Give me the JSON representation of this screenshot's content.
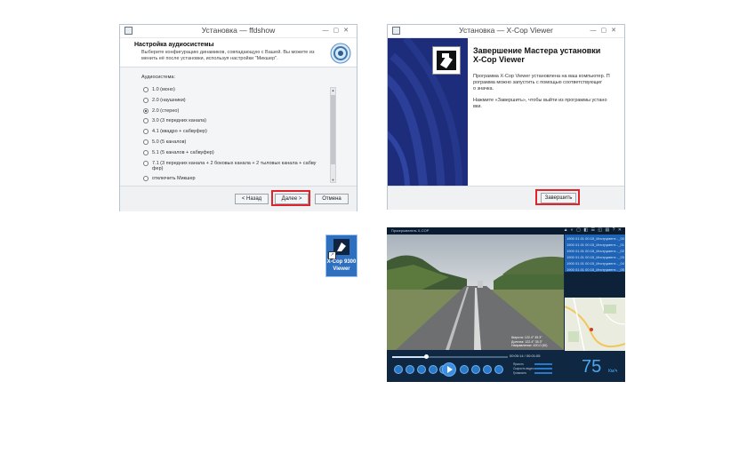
{
  "ffdshow": {
    "title": "Установка — ffdshow",
    "header_title": "Настройка аудиосистемы",
    "header_desc_1": "Выберите конфигурацию динамиков, совпадающую с Вашей. Вы можете из",
    "header_desc_2": "менить её после установки, используя настройки \"Микшер\".",
    "group_label": "Аудиосистема:",
    "options": [
      {
        "label": "1.0 (моно)",
        "checked": false
      },
      {
        "label": "2.0 (наушники)",
        "checked": false
      },
      {
        "label": "2.0 (стерео)",
        "checked": true
      },
      {
        "label": "3.0 (3 передних канала)",
        "checked": false
      },
      {
        "label": "4.1 (квадро + сабвуфер)",
        "checked": false
      },
      {
        "label": "5.0 (5 каналов)",
        "checked": false
      },
      {
        "label": "5.1 (5 каналов + сабвуфер)",
        "checked": false
      },
      {
        "label": "7.1 (3 передних канала + 2 боковых канала + 2 тыловых канала + сабву",
        "label2": "фер)",
        "checked": false
      },
      {
        "label": "отключить Микшер",
        "checked": false
      }
    ],
    "back_button": "< Назад",
    "next_button": "Далее >",
    "cancel_button": "Отмена"
  },
  "xcop_installer": {
    "title": "Установка — X-Cop Viewer",
    "finish_title_1": "Завершение Мастера установки",
    "finish_title_2": "X-Cop Viewer",
    "text_1": "Программа X-Cop Viewer установлена на ваш компьютер. П",
    "text_2": "рограмма можно запустить с помощью соответствующег",
    "text_3": "о значка.",
    "text_4": "Нажмите «Завершить», чтобы выйти из программы устано",
    "text_5": "вки.",
    "finish_button": "Завершить"
  },
  "desktop_icon": {
    "label_1": "X-Cop 9300",
    "label_2": "Viewer"
  },
  "player": {
    "title": "Проигрыватель X-COP",
    "toolbar_icons": "▲ ◐ ▢ ◧ ☰ ◱ ▤ ? ✕",
    "list": [
      "1900 01.01 00:15_Инструмент..._00",
      "1900 01.01 00:15_Инструмент..._01",
      "1900 01.01 00:15_Инструмент..._02",
      "1900 01.01 00:15_Инструмент..._03",
      "1900 01.01 00:15_Инструмент..._04",
      "1900 01.01 00:15_Инструмент..._05"
    ],
    "gps_lat_label": "Широта:",
    "gps_lat": "122.4° 35.3\"",
    "gps_lon_label": "Долгота:",
    "gps_lon": "122.4° 35.3\"",
    "gps_dir_label": "Направление:",
    "gps_dir": "420.0 (Ю)",
    "time": "00:00:14 / 00:01:05",
    "meter_1": "Яркость",
    "meter_2": "Скорость видео",
    "meter_3": "Громкость",
    "speed_value": "75",
    "speed_unit": "Км/ч",
    "colors": {
      "panel": "#0f2740",
      "accent": "#2a78c8",
      "speed": "#4aa8f0"
    }
  }
}
